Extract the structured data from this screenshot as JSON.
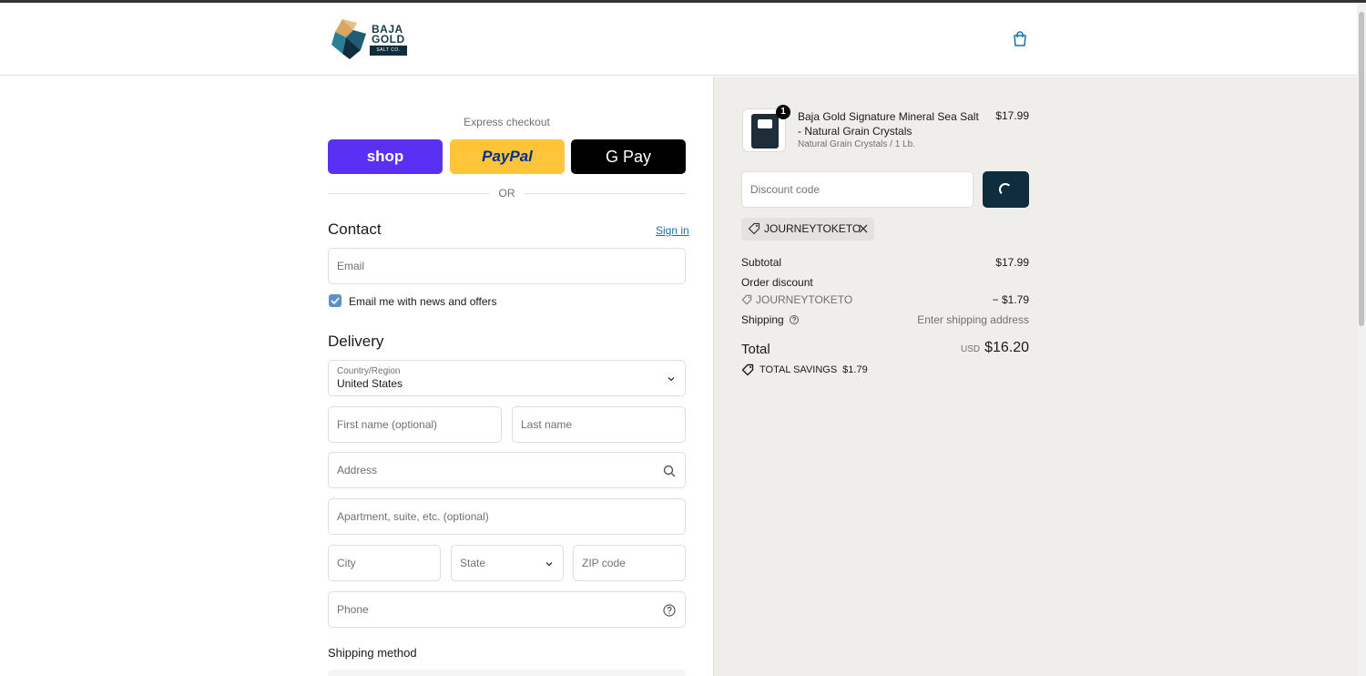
{
  "header": {
    "logo": {
      "line1": "BAJA",
      "line2": "GOLD",
      "badge": "SALT CO."
    }
  },
  "express": {
    "label": "Express checkout",
    "shop_label": "shop",
    "paypal_label": "PayPal",
    "gpay_label": "G Pay",
    "or_text": "OR"
  },
  "contact": {
    "title": "Contact",
    "sign_in": "Sign in",
    "email_placeholder": "Email",
    "news_label": "Email me with news and offers"
  },
  "delivery": {
    "title": "Delivery",
    "country_label": "Country/Region",
    "country_value": "United States",
    "first_name_placeholder": "First name (optional)",
    "last_name_placeholder": "Last name",
    "address_placeholder": "Address",
    "apartment_placeholder": "Apartment, suite, etc. (optional)",
    "city_placeholder": "City",
    "state_label": "State",
    "zip_placeholder": "ZIP code",
    "phone_placeholder": "Phone"
  },
  "shipping_method": {
    "title": "Shipping method"
  },
  "summary": {
    "product": {
      "quantity": "1",
      "name": "Baja Gold Signature Mineral Sea Salt - Natural Grain Crystals",
      "variant": "Natural Grain Crystals / 1 Lb.",
      "price": "$17.99"
    },
    "discount_placeholder": "Discount code",
    "applied_code": "JOURNEYTOKETO",
    "subtotal_label": "Subtotal",
    "subtotal_value": "$17.99",
    "order_discount_label": "Order discount",
    "order_discount_code": "JOURNEYTOKETO",
    "order_discount_value": "− $1.79",
    "shipping_label": "Shipping",
    "shipping_value": "Enter shipping address",
    "total_label": "Total",
    "currency": "USD",
    "total_value": "$16.20",
    "savings_label": "TOTAL SAVINGS",
    "savings_value": "$1.79"
  },
  "colors": {
    "shop_purple": "#5a31f4",
    "paypal_yellow": "#ffc439",
    "gpay_black": "#000000",
    "link_blue": "#1773b0",
    "dark_button": "#0f2d3d",
    "summary_bg": "#efeeea"
  }
}
